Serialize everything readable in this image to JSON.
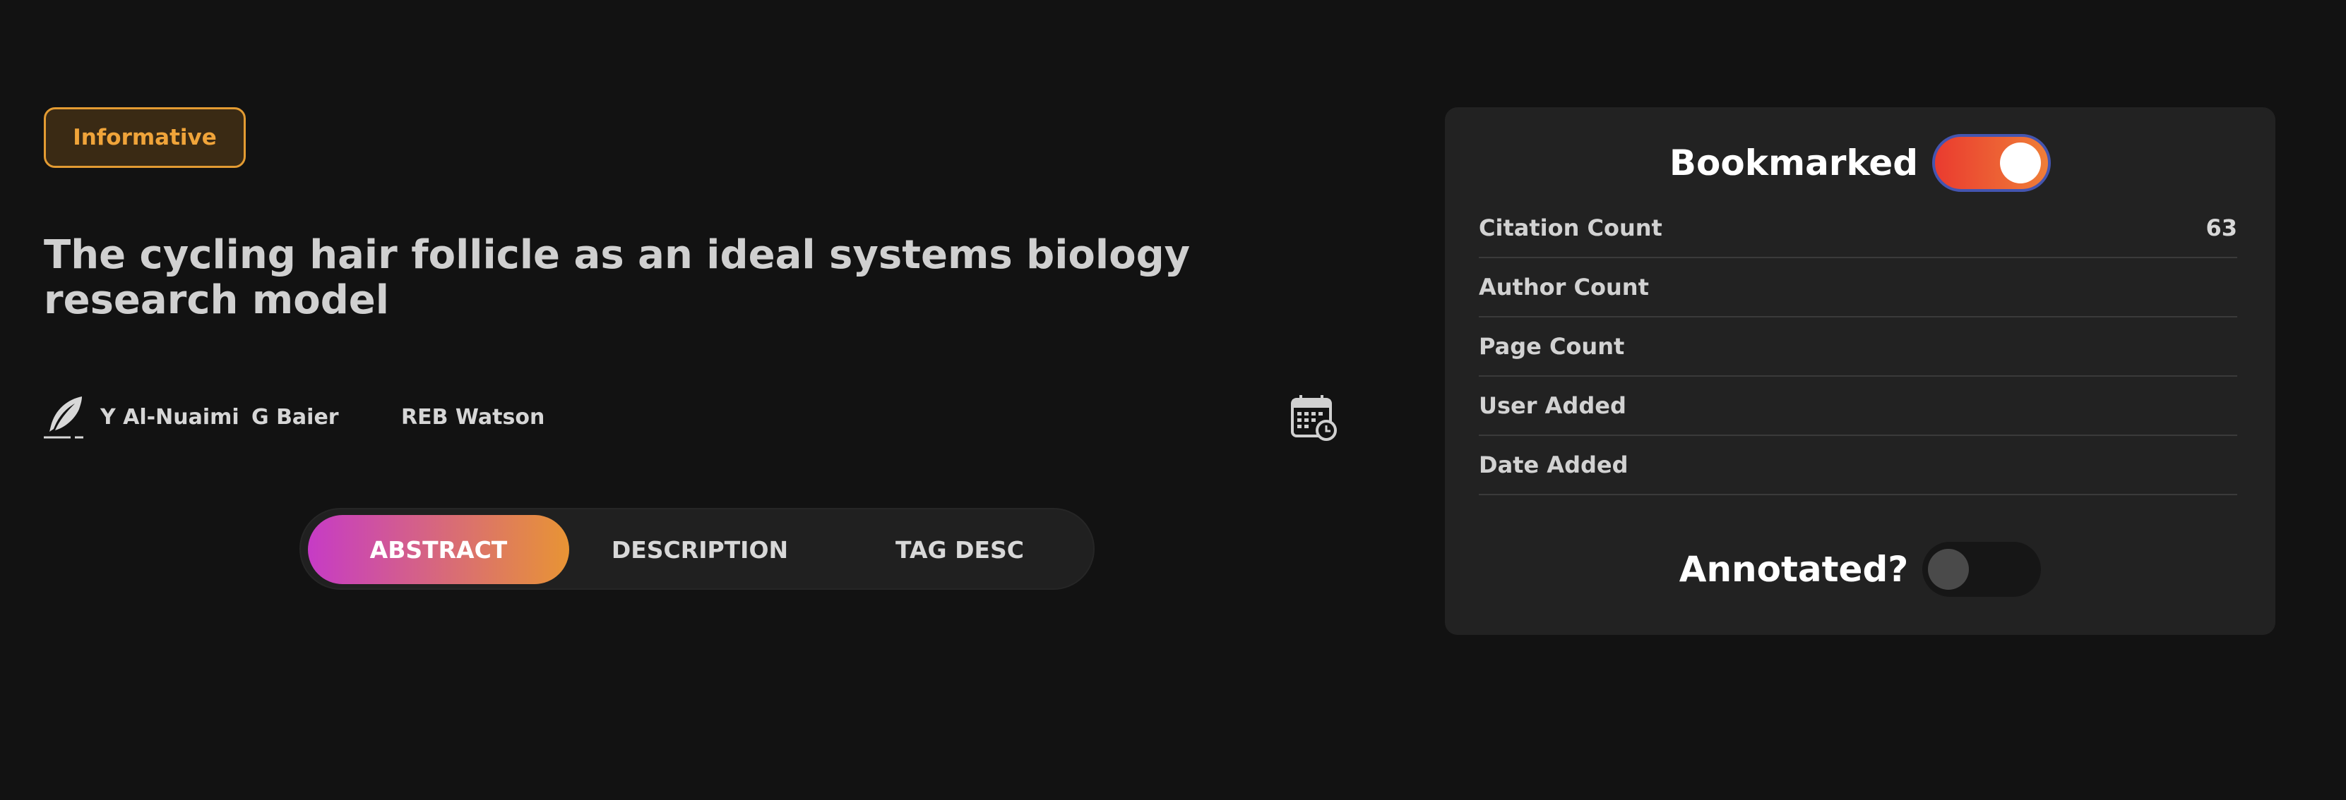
{
  "tag": {
    "label": "Informative"
  },
  "paper": {
    "title": "The cycling hair follicle as an ideal systems biology research model",
    "authors": [
      "Y Al-Nuaimi",
      "G Baier",
      "REB Watson"
    ]
  },
  "tabs": [
    {
      "label": "ABSTRACT",
      "active": true
    },
    {
      "label": "DESCRIPTION",
      "active": false
    },
    {
      "label": "TAG DESC",
      "active": false
    }
  ],
  "panel": {
    "bookmarked": {
      "label": "Bookmarked",
      "on": true
    },
    "rows": [
      {
        "label": "Citation Count",
        "value": "63"
      },
      {
        "label": "Author Count",
        "value": ""
      },
      {
        "label": "Page Count",
        "value": ""
      },
      {
        "label": "User Added",
        "value": ""
      },
      {
        "label": "Date Added",
        "value": ""
      }
    ],
    "annotated": {
      "label": "Annotated?",
      "on": false
    }
  },
  "icons": {
    "author_icon": "quill-icon",
    "date_icon": "calendar-icon"
  },
  "colors": {
    "background": "#121212",
    "panel": "#222222",
    "accent_orange": "#e39b32",
    "tab_gradient": [
      "#c63bc6",
      "#e89434"
    ],
    "toggle_gradient": [
      "#ea3b2f",
      "#ef7e38"
    ]
  }
}
